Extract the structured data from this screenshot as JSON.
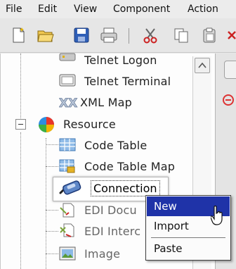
{
  "menu": [
    {
      "label": "File"
    },
    {
      "label": "Edit"
    },
    {
      "label": "View"
    },
    {
      "label": "Component"
    },
    {
      "label": "Action"
    }
  ],
  "toolbar": [
    {
      "icon": "new-document-icon"
    },
    {
      "icon": "open-folder-icon"
    },
    {
      "icon": "save-icon"
    },
    {
      "icon": "print-icon"
    },
    {
      "icon": "cut-icon"
    },
    {
      "icon": "copy-icon"
    },
    {
      "icon": "paste-icon"
    }
  ],
  "tree": {
    "items": [
      {
        "label": "Telnet Logon",
        "icon": "telnet-logon-icon"
      },
      {
        "label": "Telnet Terminal",
        "icon": "telnet-terminal-icon"
      },
      {
        "label": "XML Map",
        "icon": "xml-map-icon"
      },
      {
        "label": "Resource",
        "icon": "resource-icon"
      },
      {
        "label": "Code Table",
        "icon": "code-table-icon"
      },
      {
        "label": "Code Table Map",
        "icon": "code-table-map-icon"
      },
      {
        "label": "Connection",
        "icon": "connection-icon"
      },
      {
        "label": "EDI Docu",
        "icon": "edi-document-icon"
      },
      {
        "label": "EDI Interc",
        "icon": "edi-interchange-icon"
      },
      {
        "label": "Image",
        "icon": "image-icon"
      }
    ]
  },
  "context_menu": {
    "items": [
      {
        "label": "New"
      },
      {
        "label": "Import"
      },
      {
        "label": "Paste"
      }
    ]
  }
}
